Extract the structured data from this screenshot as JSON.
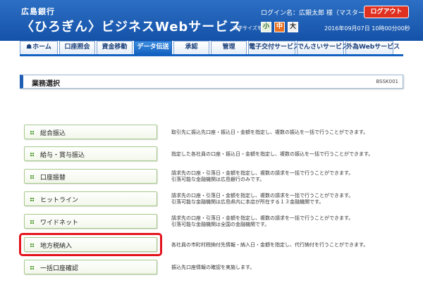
{
  "header": {
    "bank_name": "広島銀行",
    "service_name": "〈ひろぎん〉ビジネスWebサービス",
    "login_name": "ログイン名：広銀太郎 様（マスターユーザ）",
    "logout_label": "ログアウト",
    "font_size_label": "文字サイズを変更",
    "font_small": "小",
    "font_medium": "中",
    "font_large": "大",
    "datetime": "2016年09月07日 10時00分00秒"
  },
  "nav": {
    "tabs": [
      {
        "label": "ホーム"
      },
      {
        "label": "口座照会"
      },
      {
        "label": "資金移動"
      },
      {
        "label": "データ伝送"
      },
      {
        "label": "承認"
      },
      {
        "label": "管理"
      },
      {
        "label": "電子交付サービス"
      },
      {
        "label": "でんさいサービス"
      },
      {
        "label": "外為Webサービス"
      }
    ],
    "active_index": 3
  },
  "page": {
    "title": "業務選択",
    "screen_id": "BSSK001"
  },
  "menu": [
    {
      "label": "総合振込",
      "desc": [
        "取引先に振込先口座・振込日・金額を指定し、複数の振込を一括で行うことができます。"
      ]
    },
    {
      "label": "給与・賞与振込",
      "desc": [
        "指定した各社員の口座・振込日・金額を指定し、複数の振込を一括で行うことができます。"
      ]
    },
    {
      "label": "口座振替",
      "desc": [
        "請求先の口座・引落日・金額を指定し、複数の請求を一括で行うことができます。",
        "引落可能な金融機関は広島銀行のみです。"
      ]
    },
    {
      "label": "ヒットライン",
      "desc": [
        "請求先の口座・引落日・金額を指定し、複数の請求を一括で行うことができます。",
        "引落可能な金融機関は広島県内に本店が所在する１３金融機関です。"
      ]
    },
    {
      "label": "ワイドネット",
      "desc": [
        "請求先の口座・引落日・金額を指定し、複数の請求を一括で行うことができます。",
        "引落可能な金融機関は全国の金融機関です。"
      ]
    },
    {
      "label": "地方税納入",
      "desc": [
        "各社員の市町村税納付先情報・納入日・金額を指定し、代行納付を行うことができます。"
      ]
    },
    {
      "label": "一括口座確認",
      "desc": [
        "振込先口座情報の確認を実施します。"
      ]
    }
  ],
  "colors": {
    "header_blue": "#1452a8",
    "active_tab": "#1462c0",
    "logout_red": "#e03020",
    "highlight_red": "#e4141e",
    "menu_border_green": "#a6c98a"
  }
}
